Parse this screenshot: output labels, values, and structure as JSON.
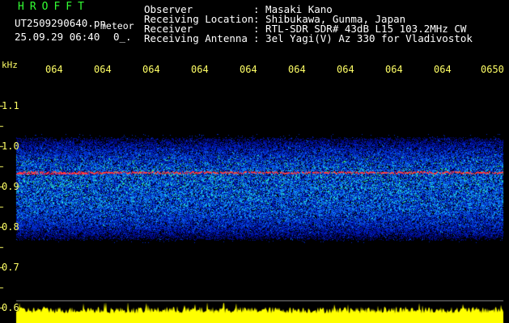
{
  "header": {
    "app_name": "HROFFT",
    "file_name": "UT2509290640.pn",
    "mode": "meteor",
    "datetime": "25.09.29 06:40",
    "counter": "0_.",
    "info": [
      {
        "label": "Observer",
        "value": ": Masaki Kano"
      },
      {
        "label": "Receiving Location",
        "value": ": Shibukawa, Gunma, Japan"
      },
      {
        "label": "Receiver",
        "value": ": RTL-SDR SDR# 43dB L15 103.2MHz CW"
      },
      {
        "label": "Receiving Antenna",
        "value": ": 3el Yagi(V) Az 330 for Vladivostok"
      }
    ]
  },
  "axes": {
    "y_unit": "kHz",
    "y_ticks": [
      "1.1",
      "1.0",
      "0.9",
      "0.8",
      "0.7",
      "0.6"
    ],
    "x_ticks": [
      "064",
      "064",
      "064",
      "064",
      "064",
      "064",
      "064",
      "064",
      "064",
      "0650"
    ]
  },
  "colors": {
    "background": "#000000",
    "text": "#ffffff",
    "label_yellow": "#ffff66",
    "title_green": "#33ff33",
    "signal_red": "#ff3030",
    "baseline_yellow": "#ffff00"
  },
  "display": {
    "type": "waterfall spectrogram",
    "signal_band_khz": [
      0.76,
      1.03
    ],
    "meteor_trace_khz": 0.935
  }
}
